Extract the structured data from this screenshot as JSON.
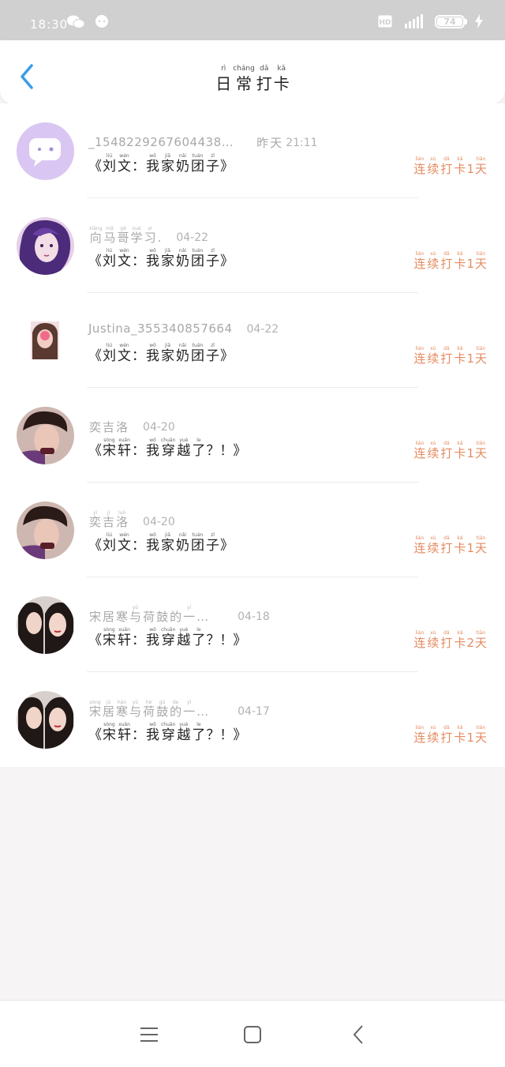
{
  "status_bar": {
    "time": "18:30",
    "battery": "74",
    "hd_badge": "HD"
  },
  "header": {
    "title": [
      {
        "py": "rì",
        "hz": "日"
      },
      {
        "py": "cháng",
        "hz": "常"
      },
      {
        "py": "dǎ",
        "hz": "打"
      },
      {
        "py": "kǎ",
        "hz": "卡"
      }
    ],
    "back_icon": "chevron-left-icon",
    "accent_color": "#3a9de8"
  },
  "rows": [
    {
      "name_plain": "_1548229267604438…",
      "date_words": [
        {
          "py": "",
          "hz": "昨"
        },
        {
          "py": "",
          "hz": "天"
        }
      ],
      "date": "21:11",
      "content": [
        {
          "t": "p",
          "v": "《"
        },
        {
          "py": "liú",
          "hz": "刘"
        },
        {
          "py": "wén",
          "hz": "文"
        },
        {
          "t": "p",
          "v": "："
        },
        {
          "py": "wǒ",
          "hz": "我"
        },
        {
          "py": "jiā",
          "hz": "家"
        },
        {
          "py": "nǎi",
          "hz": "奶"
        },
        {
          "py": "tuán",
          "hz": "团"
        },
        {
          "py": "zǐ",
          "hz": "子"
        },
        {
          "t": "p",
          "v": "》"
        }
      ],
      "streak": {
        "n": "1"
      }
    },
    {
      "name_words": [
        {
          "py": "xiàng",
          "hz": "向"
        },
        {
          "py": "mǎ",
          "hz": "马"
        },
        {
          "py": "gē",
          "hz": "哥"
        },
        {
          "py": "xué",
          "hz": "学"
        },
        {
          "py": "xí",
          "hz": "习"
        },
        {
          "py": "",
          "hz": "."
        }
      ],
      "date": "04-22",
      "content": [
        {
          "t": "p",
          "v": "《"
        },
        {
          "py": "liú",
          "hz": "刘"
        },
        {
          "py": "wén",
          "hz": "文"
        },
        {
          "t": "p",
          "v": "："
        },
        {
          "py": "wǒ",
          "hz": "我"
        },
        {
          "py": "jiā",
          "hz": "家"
        },
        {
          "py": "nǎi",
          "hz": "奶"
        },
        {
          "py": "tuán",
          "hz": "团"
        },
        {
          "py": "zǐ",
          "hz": "子"
        },
        {
          "t": "p",
          "v": "》"
        }
      ],
      "streak": {
        "n": "1"
      }
    },
    {
      "name_plain": "Justina_355340857664",
      "date": "04-22",
      "content": [
        {
          "t": "p",
          "v": "《"
        },
        {
          "py": "liú",
          "hz": "刘"
        },
        {
          "py": "wén",
          "hz": "文"
        },
        {
          "t": "p",
          "v": "："
        },
        {
          "py": "wǒ",
          "hz": "我"
        },
        {
          "py": "jiā",
          "hz": "家"
        },
        {
          "py": "nǎi",
          "hz": "奶"
        },
        {
          "py": "tuán",
          "hz": "团"
        },
        {
          "py": "zǐ",
          "hz": "子"
        },
        {
          "t": "p",
          "v": "》"
        }
      ],
      "streak": {
        "n": "1"
      }
    },
    {
      "name_words": [
        {
          "py": "",
          "hz": "奕"
        },
        {
          "py": "",
          "hz": "吉"
        },
        {
          "py": "",
          "hz": "洛"
        }
      ],
      "date": "04-20",
      "content": [
        {
          "t": "p",
          "v": "《"
        },
        {
          "py": "sòng",
          "hz": "宋"
        },
        {
          "py": "xuān",
          "hz": "轩"
        },
        {
          "t": "p",
          "v": "："
        },
        {
          "py": "wǒ",
          "hz": "我"
        },
        {
          "py": "chuān",
          "hz": "穿"
        },
        {
          "py": "yuè",
          "hz": "越"
        },
        {
          "py": "le",
          "hz": "了"
        },
        {
          "t": "p",
          "v": "？！》"
        }
      ],
      "streak": {
        "n": "1"
      }
    },
    {
      "name_words": [
        {
          "py": "yì",
          "hz": "奕"
        },
        {
          "py": "jí",
          "hz": "吉"
        },
        {
          "py": "luò",
          "hz": "洛"
        }
      ],
      "date": "04-20",
      "content": [
        {
          "t": "p",
          "v": "《"
        },
        {
          "py": "liú",
          "hz": "刘"
        },
        {
          "py": "wén",
          "hz": "文"
        },
        {
          "t": "p",
          "v": "："
        },
        {
          "py": "wǒ",
          "hz": "我"
        },
        {
          "py": "jiā",
          "hz": "家"
        },
        {
          "py": "nǎi",
          "hz": "奶"
        },
        {
          "py": "tuán",
          "hz": "团"
        },
        {
          "py": "zǐ",
          "hz": "子"
        },
        {
          "t": "p",
          "v": "》"
        }
      ],
      "streak": {
        "n": "1"
      }
    },
    {
      "name_words": [
        {
          "py": "",
          "hz": "宋"
        },
        {
          "py": "",
          "hz": "居"
        },
        {
          "py": "",
          "hz": "寒"
        },
        {
          "py": "yǔ",
          "hz": "与"
        },
        {
          "py": "",
          "hz": "荷"
        },
        {
          "py": "",
          "hz": "鼓"
        },
        {
          "py": "",
          "hz": "的"
        },
        {
          "py": "yī",
          "hz": "一"
        },
        {
          "py": "",
          "hz": "…"
        }
      ],
      "date": "04-18",
      "content": [
        {
          "t": "p",
          "v": "《"
        },
        {
          "py": "sòng",
          "hz": "宋"
        },
        {
          "py": "xuān",
          "hz": "轩"
        },
        {
          "t": "p",
          "v": "："
        },
        {
          "py": "wǒ",
          "hz": "我"
        },
        {
          "py": "chuān",
          "hz": "穿"
        },
        {
          "py": "yuè",
          "hz": "越"
        },
        {
          "py": "le",
          "hz": "了"
        },
        {
          "t": "p",
          "v": "？！》"
        }
      ],
      "streak": {
        "n": "2"
      }
    },
    {
      "name_words": [
        {
          "py": "sòng",
          "hz": "宋"
        },
        {
          "py": "jū",
          "hz": "居"
        },
        {
          "py": "hán",
          "hz": "寒"
        },
        {
          "py": "yǔ",
          "hz": "与"
        },
        {
          "py": "hé",
          "hz": "荷"
        },
        {
          "py": "gǔ",
          "hz": "鼓"
        },
        {
          "py": "de",
          "hz": "的"
        },
        {
          "py": "yī",
          "hz": "一"
        },
        {
          "py": "",
          "hz": "…"
        }
      ],
      "date": "04-17",
      "content": [
        {
          "t": "p",
          "v": "《"
        },
        {
          "py": "sòng",
          "hz": "宋"
        },
        {
          "py": "xuān",
          "hz": "轩"
        },
        {
          "t": "p",
          "v": "："
        },
        {
          "py": "wǒ",
          "hz": "我"
        },
        {
          "py": "chuān",
          "hz": "穿"
        },
        {
          "py": "yuè",
          "hz": "越"
        },
        {
          "py": "le",
          "hz": "了"
        },
        {
          "t": "p",
          "v": "？！》"
        }
      ],
      "streak": {
        "n": "1"
      }
    }
  ],
  "streak_words": [
    {
      "py": "lián",
      "hz": "连"
    },
    {
      "py": "xù",
      "hz": "续"
    },
    {
      "py": "dǎ",
      "hz": "打"
    },
    {
      "py": "kǎ",
      "hz": "卡"
    }
  ],
  "streak_unit": {
    "py": "tiān",
    "hz": "天"
  },
  "nav": {
    "menu_icon": "menu-icon",
    "home_icon": "home-square-icon",
    "back_icon": "back-chevron-icon"
  }
}
